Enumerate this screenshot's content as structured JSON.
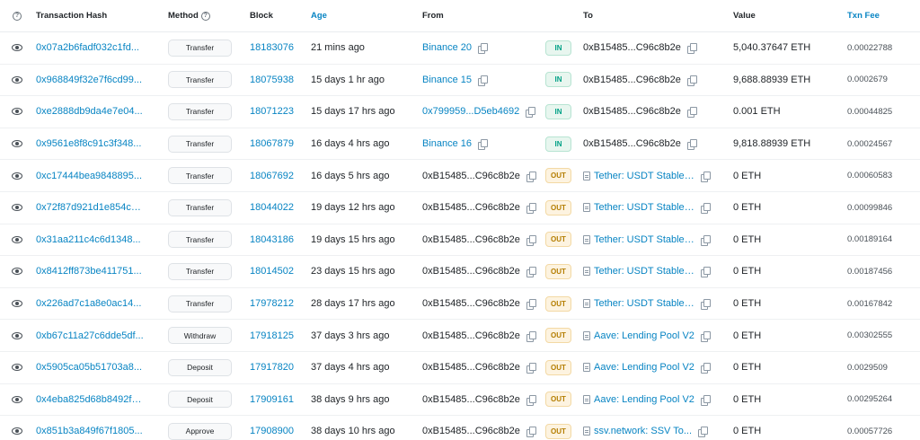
{
  "headers": {
    "info": "?",
    "hash": "Transaction Hash",
    "method": "Method",
    "block": "Block",
    "age": "Age",
    "from": "From",
    "to": "To",
    "value": "Value",
    "fee": "Txn Fee"
  },
  "rows": [
    {
      "hash": "0x07a2b6fadf032c1fd...",
      "method": "Transfer",
      "block": "18183076",
      "age": "21 mins ago",
      "from": "Binance 20",
      "from_link": true,
      "dir": "IN",
      "to": "0xB15485...C96c8b2e",
      "to_link": false,
      "to_contract": false,
      "value": "5,040.37647 ETH",
      "fee": "0.00022788"
    },
    {
      "hash": "0x968849f32e7f6cd99...",
      "method": "Transfer",
      "block": "18075938",
      "age": "15 days 1 hr ago",
      "from": "Binance 15",
      "from_link": true,
      "dir": "IN",
      "to": "0xB15485...C96c8b2e",
      "to_link": false,
      "to_contract": false,
      "value": "9,688.88939 ETH",
      "fee": "0.0002679"
    },
    {
      "hash": "0xe2888db9da4e7e04...",
      "method": "Transfer",
      "block": "18071223",
      "age": "15 days 17 hrs ago",
      "from": "0x799959...D5eb4692",
      "from_link": true,
      "dir": "IN",
      "to": "0xB15485...C96c8b2e",
      "to_link": false,
      "to_contract": false,
      "value": "0.001 ETH",
      "fee": "0.00044825"
    },
    {
      "hash": "0x9561e8f8c91c3f348...",
      "method": "Transfer",
      "block": "18067879",
      "age": "16 days 4 hrs ago",
      "from": "Binance 16",
      "from_link": true,
      "dir": "IN",
      "to": "0xB15485...C96c8b2e",
      "to_link": false,
      "to_contract": false,
      "value": "9,818.88939 ETH",
      "fee": "0.00024567"
    },
    {
      "hash": "0xc17444bea9848895...",
      "method": "Transfer",
      "block": "18067692",
      "age": "16 days 5 hrs ago",
      "from": "0xB15485...C96c8b2e",
      "from_link": false,
      "dir": "OUT",
      "to": "Tether: USDT Stablec...",
      "to_link": true,
      "to_contract": true,
      "value": "0 ETH",
      "fee": "0.00060583"
    },
    {
      "hash": "0x72f87d921d1e854ce...",
      "method": "Transfer",
      "block": "18044022",
      "age": "19 days 12 hrs ago",
      "from": "0xB15485...C96c8b2e",
      "from_link": false,
      "dir": "OUT",
      "to": "Tether: USDT Stablec...",
      "to_link": true,
      "to_contract": true,
      "value": "0 ETH",
      "fee": "0.00099846"
    },
    {
      "hash": "0x31aa211c4c6d1348...",
      "method": "Transfer",
      "block": "18043186",
      "age": "19 days 15 hrs ago",
      "from": "0xB15485...C96c8b2e",
      "from_link": false,
      "dir": "OUT",
      "to": "Tether: USDT Stablec...",
      "to_link": true,
      "to_contract": true,
      "value": "0 ETH",
      "fee": "0.00189164"
    },
    {
      "hash": "0x8412ff873be411751...",
      "method": "Transfer",
      "block": "18014502",
      "age": "23 days 15 hrs ago",
      "from": "0xB15485...C96c8b2e",
      "from_link": false,
      "dir": "OUT",
      "to": "Tether: USDT Stablec...",
      "to_link": true,
      "to_contract": true,
      "value": "0 ETH",
      "fee": "0.00187456"
    },
    {
      "hash": "0x226ad7c1a8e0ac14...",
      "method": "Transfer",
      "block": "17978212",
      "age": "28 days 17 hrs ago",
      "from": "0xB15485...C96c8b2e",
      "from_link": false,
      "dir": "OUT",
      "to": "Tether: USDT Stablec...",
      "to_link": true,
      "to_contract": true,
      "value": "0 ETH",
      "fee": "0.00167842"
    },
    {
      "hash": "0xb67c11a27c6dde5df...",
      "method": "Withdraw",
      "block": "17918125",
      "age": "37 days 3 hrs ago",
      "from": "0xB15485...C96c8b2e",
      "from_link": false,
      "dir": "OUT",
      "to": "Aave: Lending Pool V2",
      "to_link": true,
      "to_contract": true,
      "value": "0 ETH",
      "fee": "0.00302555"
    },
    {
      "hash": "0x5905ca05b51703a8...",
      "method": "Deposit",
      "block": "17917820",
      "age": "37 days 4 hrs ago",
      "from": "0xB15485...C96c8b2e",
      "from_link": false,
      "dir": "OUT",
      "to": "Aave: Lending Pool V2",
      "to_link": true,
      "to_contract": true,
      "value": "0 ETH",
      "fee": "0.0029509"
    },
    {
      "hash": "0x4eba825d68b8492fe...",
      "method": "Deposit",
      "block": "17909161",
      "age": "38 days 9 hrs ago",
      "from": "0xB15485...C96c8b2e",
      "from_link": false,
      "dir": "OUT",
      "to": "Aave: Lending Pool V2",
      "to_link": true,
      "to_contract": true,
      "value": "0 ETH",
      "fee": "0.00295264"
    },
    {
      "hash": "0x851b3a849f67f1805...",
      "method": "Approve",
      "block": "17908900",
      "age": "38 days 10 hrs ago",
      "from": "0xB15485...C96c8b2e",
      "from_link": false,
      "dir": "OUT",
      "to": "ssv.network: SSV To...",
      "to_link": true,
      "to_contract": true,
      "value": "0 ETH",
      "fee": "0.00057726"
    }
  ],
  "colors": {
    "link": "#0784c3",
    "in_badge": "#00a186",
    "out_badge": "#b47d00"
  }
}
